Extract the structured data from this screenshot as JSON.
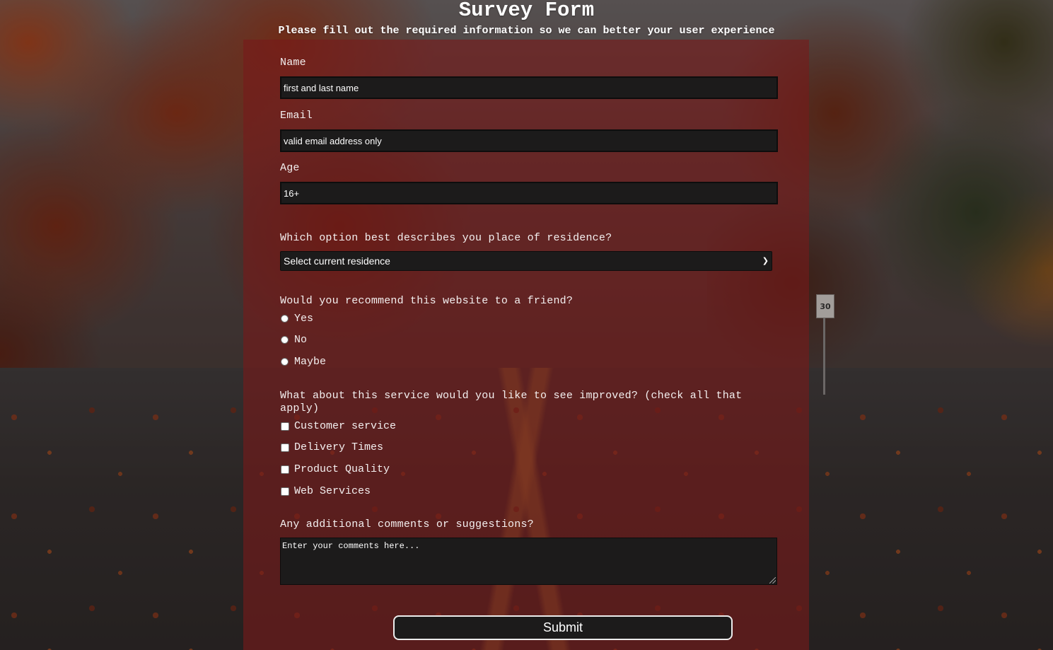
{
  "header": {
    "title": "Survey Form",
    "subtitle": "Please fill out the required information so we can better your user experience"
  },
  "form": {
    "name": {
      "label": "Name",
      "placeholder": "first and last name"
    },
    "email": {
      "label": "Email",
      "placeholder": "valid email address only"
    },
    "age": {
      "label": "Age",
      "placeholder": "16+"
    },
    "residence": {
      "label": "Which option best describes you place of residence?",
      "selected": "Select current residence"
    },
    "recommend": {
      "label": "Would you recommend this website to a friend?",
      "options": [
        "Yes",
        "No",
        "Maybe"
      ]
    },
    "improve": {
      "label": "What about this service would you like to see improved? (check all that apply)",
      "options": [
        "Customer service",
        "Delivery Times",
        "Product Quality",
        "Web Services"
      ]
    },
    "comments": {
      "label": "Any additional comments or suggestions?",
      "placeholder": "Enter your comments here..."
    },
    "submit_label": "Submit"
  },
  "background": {
    "road_sign": "30"
  },
  "colors": {
    "card_overlay": "#781a1a",
    "input_bg": "#1c1b1b",
    "text": "#f4f0f0"
  }
}
